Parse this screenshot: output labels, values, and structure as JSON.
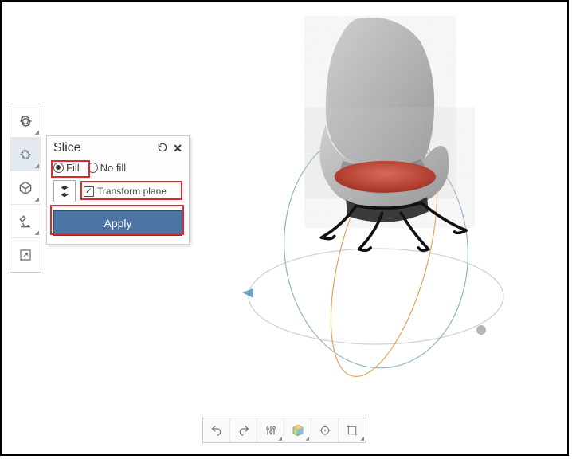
{
  "panel": {
    "title": "Slice",
    "radio_fill": "Fill",
    "radio_nofill": "No fill",
    "transform_plane": "Transform plane",
    "apply": "Apply",
    "fill_selected": true,
    "transform_checked": true
  },
  "icons": {
    "settings": "gear-icon",
    "slice": "slice-gear-icon",
    "hex": "hexagon-icon",
    "microscope": "microscope-icon",
    "external": "external-window-icon",
    "reset": "reset-icon",
    "close": "close-icon",
    "axis": "axis-z-icon"
  },
  "bottom_tools": [
    "undo",
    "redo",
    "adjust",
    "cube-view",
    "focus-target",
    "crop"
  ],
  "colors": {
    "accent": "#4d75a3",
    "highlight": "#e02a2a",
    "chair_body": "#b8b8b8",
    "chair_cushion": "#c84a3c"
  }
}
